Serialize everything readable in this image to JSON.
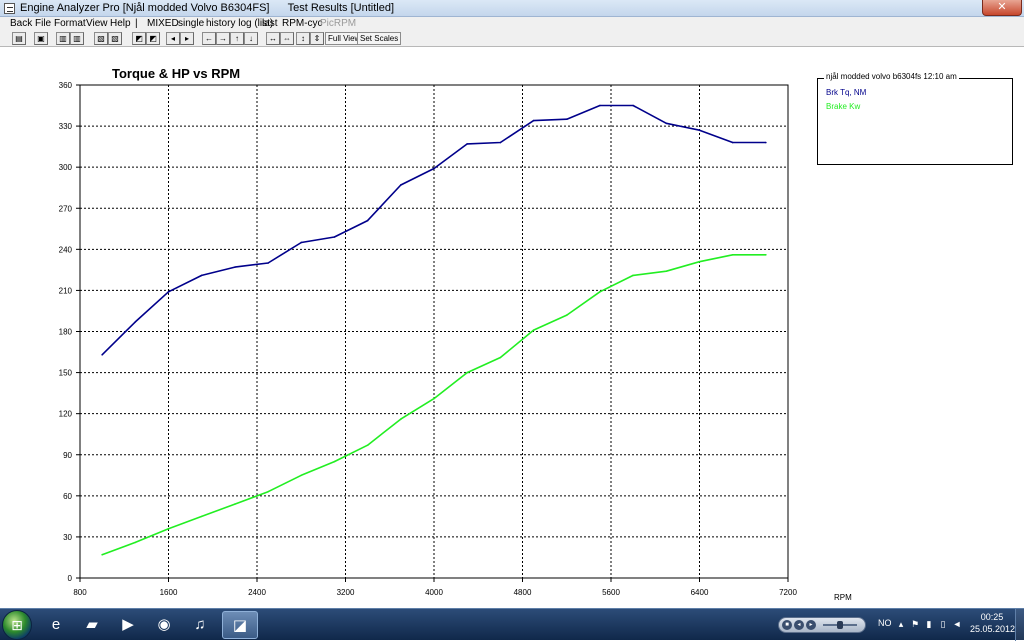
{
  "window": {
    "title": "Engine Analyzer Pro [Njål modded Volvo B6304FS]      Test Results [Untitled]",
    "close_glyph": "✕"
  },
  "menu": {
    "items": [
      {
        "label": "Back"
      },
      {
        "label": "File"
      },
      {
        "label": "Format"
      },
      {
        "label": "View"
      },
      {
        "label": "Help"
      },
      {
        "label": "|"
      },
      {
        "label": "MIXED"
      },
      {
        "label": "single"
      },
      {
        "label": "history log (list)"
      },
      {
        "label": "last"
      },
      {
        "label": "RPM-cyc"
      },
      {
        "label": "PicRPM",
        "disabled": true
      }
    ]
  },
  "toolbar": {
    "icons": [
      "print-icon",
      "save-icon",
      "chart-icon",
      "chart-icon",
      "zoom-icon",
      "zoom-icon",
      "graph-icon",
      "graph-icon",
      "prev-icon",
      "next-icon",
      "arrow-left-icon",
      "arrow-right-icon",
      "arrow-up-icon",
      "arrow-down-icon",
      "shrink-h-icon",
      "expand-h-icon",
      "shrink-v-icon",
      "expand-v-icon"
    ],
    "glyphs": [
      "▤",
      "▣",
      "▥",
      "▥",
      "▧",
      "▧",
      "◩",
      "◩",
      "◂",
      "▸",
      "←",
      "→",
      "↑",
      "↓",
      "↔",
      "⇔",
      "↕",
      "⇕"
    ],
    "full_view_label": "Full View",
    "set_scales_label": "Set Scales"
  },
  "chart_data": {
    "type": "line",
    "title": "Torque & HP vs RPM",
    "xlabel": "RPM",
    "ylabel": "",
    "xlim": [
      800,
      7200
    ],
    "ylim": [
      0,
      360
    ],
    "xticks": [
      800,
      1600,
      2400,
      3200,
      4000,
      4800,
      5600,
      6400,
      7200
    ],
    "yticks": [
      0,
      30,
      60,
      90,
      120,
      150,
      180,
      210,
      240,
      270,
      300,
      330,
      360
    ],
    "grid": true,
    "legend": {
      "title": "njål modded volvo b6304fs 12:10 am",
      "placement": "right"
    },
    "series": [
      {
        "name": "Brk Tq, NM",
        "color": "#00008b",
        "x": [
          1000,
          1300,
          1600,
          1900,
          2200,
          2500,
          2800,
          3100,
          3400,
          3700,
          4000,
          4300,
          4600,
          4900,
          5200,
          5500,
          5800,
          6100,
          6400,
          6700,
          7000
        ],
        "y": [
          163,
          187,
          209,
          221,
          227,
          230,
          245,
          249,
          261,
          287,
          299,
          317,
          318,
          334,
          335,
          345,
          345,
          332,
          327,
          318,
          318
        ]
      },
      {
        "name": "Brake Kw",
        "color": "#22ee22",
        "x": [
          1000,
          1300,
          1600,
          1900,
          2200,
          2500,
          2800,
          3100,
          3400,
          3700,
          4000,
          4300,
          4600,
          4900,
          5200,
          5500,
          5800,
          6100,
          6400,
          6700,
          7000
        ],
        "y": [
          17,
          26,
          36,
          45,
          54,
          63,
          75,
          85,
          97,
          116,
          131,
          150,
          161,
          181,
          192,
          209,
          221,
          224,
          231,
          236,
          236
        ]
      }
    ]
  },
  "taskbar": {
    "start_glyph": "⊞",
    "apps": [
      {
        "name": "taskbar-internet-explorer-icon",
        "glyph": "e"
      },
      {
        "name": "taskbar-file-explorer-icon",
        "glyph": "▰"
      },
      {
        "name": "taskbar-media-player-icon",
        "glyph": "▶"
      },
      {
        "name": "taskbar-firefox-icon",
        "glyph": "◉"
      },
      {
        "name": "taskbar-itunes-icon",
        "glyph": "♫"
      },
      {
        "name": "taskbar-engine-analyzer-icon",
        "glyph": "◪"
      }
    ],
    "language": "NO",
    "clock_time": "00:25",
    "clock_date": "25.05.2012"
  }
}
